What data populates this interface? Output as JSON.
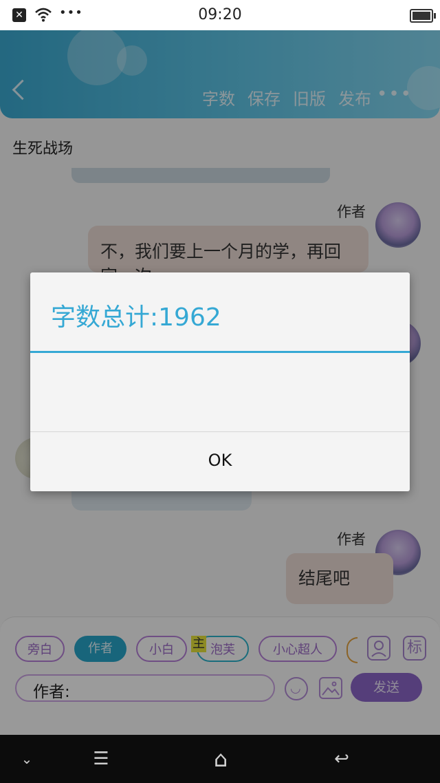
{
  "status_bar": {
    "time": "09:20",
    "close_icon": "close-icon",
    "wifi_icon": "wifi-icon",
    "more_dots": "•••",
    "battery_icon": "battery-icon"
  },
  "header": {
    "back_icon": "back-arrow-icon",
    "actions": [
      "字数",
      "保存",
      "旧版",
      "发布"
    ],
    "more": "•••"
  },
  "story": {
    "title": "生死战场"
  },
  "messages": [
    {
      "speaker": "作者",
      "text": "不，我们要上一个月的学，再回家一次"
    },
    {
      "speaker": "作者",
      "text": "结尾吧"
    }
  ],
  "dialog": {
    "title": "字数总计:1962",
    "ok_label": "OK"
  },
  "role_chips": [
    "旁白",
    "作者",
    "小白",
    "泡芙",
    "小心超人"
  ],
  "role_badge": "主",
  "side_icons": {
    "label_text": "标"
  },
  "input": {
    "prefix": "作者:",
    "send_label": "发送"
  },
  "nav": {
    "down": "⌄",
    "menu": "☰",
    "home": "⌂",
    "back": "↩"
  },
  "colors": {
    "accent": "#35a8d4",
    "send": "#8a64c6",
    "chip_selected": "#27a3c7"
  }
}
